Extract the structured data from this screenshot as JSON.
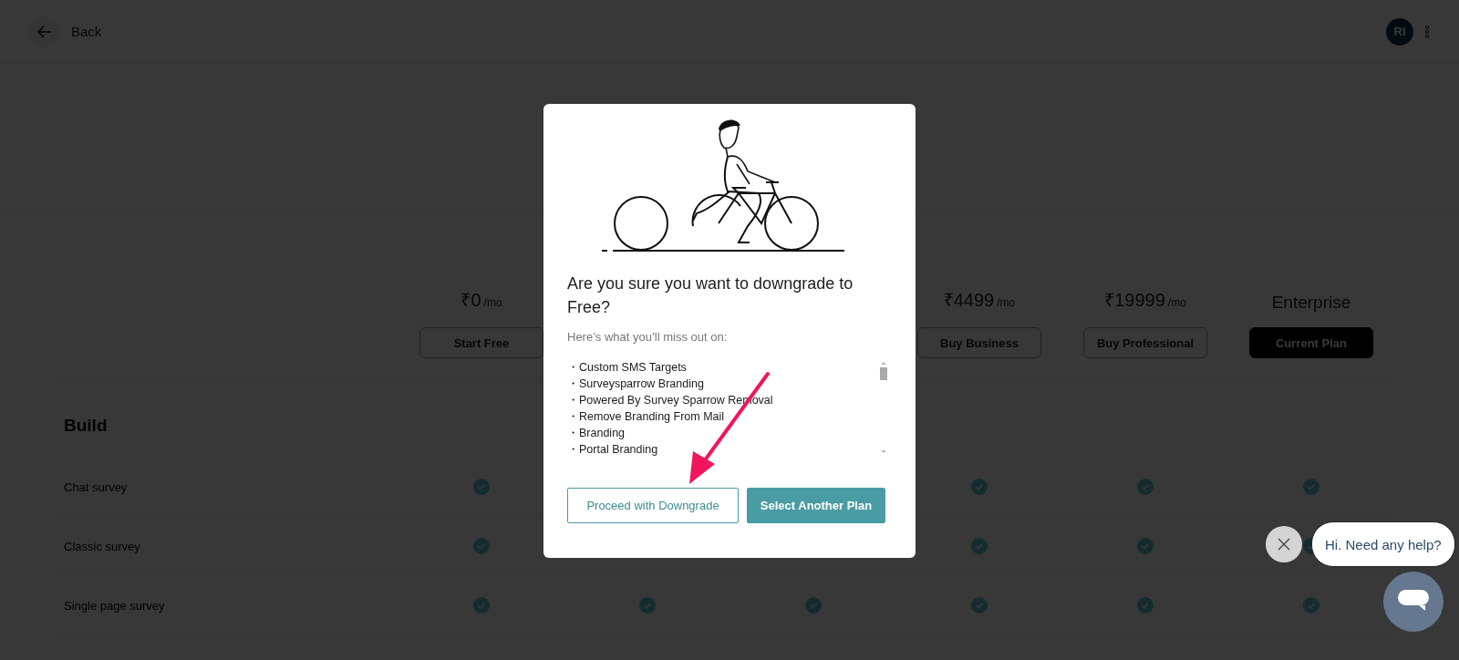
{
  "top_bar": {
    "back_label": "Back",
    "avatar_initials": "RI"
  },
  "plans": [
    {
      "price": "₹0",
      "unit": "/mo",
      "button": "Start Free",
      "current": false
    },
    {
      "price": "₹4499",
      "unit": "/mo",
      "button": "Buy Business",
      "current": false
    },
    {
      "price": "₹19999",
      "unit": "/mo",
      "button": "Buy Professional",
      "current": false
    },
    {
      "name": "Enterprise",
      "button": "Current Plan",
      "current": true
    }
  ],
  "section_title": "Build",
  "features": [
    {
      "name": "Chat survey",
      "included": [
        true,
        true,
        true,
        true
      ]
    },
    {
      "name": "Classic survey",
      "included": [
        true,
        true,
        true,
        true
      ]
    },
    {
      "name": "Single page survey",
      "included": [
        true,
        true,
        true,
        true,
        true,
        true
      ]
    }
  ],
  "dialog": {
    "title": "Are you sure you want to downgrade to Free?",
    "subtitle": "Here’s what you’ll miss out on:",
    "missing_features": [
      "・Custom SMS Targets",
      "・Surveysparrow Branding",
      "・Powered By Survey Sparrow Removal",
      "・Remove Branding From Mail",
      "・Branding",
      "・Portal Branding"
    ],
    "buttons": [
      {
        "label": "Proceed with Downgrade",
        "kind": "outline"
      },
      {
        "label": "Select Another Plan",
        "kind": "primary"
      }
    ]
  },
  "chat": {
    "greeting": "Hi. Need any help?"
  }
}
